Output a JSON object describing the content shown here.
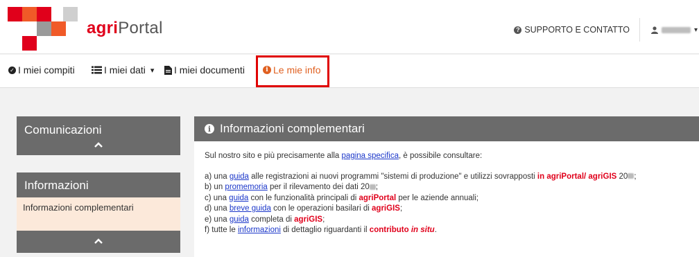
{
  "header": {
    "brand_part1": "agri",
    "brand_part2": "Portal",
    "support_label": "SUPPORTO E CONTATTO",
    "user_caret": "▾"
  },
  "nav": {
    "items": [
      {
        "label": "I miei compiti",
        "icon": "check-circle-icon"
      },
      {
        "label": "I miei dati",
        "icon": "list-icon",
        "caret": "▾"
      },
      {
        "label": "I miei documenti",
        "icon": "document-icon"
      },
      {
        "label": "Le mie info",
        "icon": "info-circle-icon",
        "active": true
      }
    ]
  },
  "sidebar": {
    "sections": [
      {
        "title": "Comunicazioni"
      },
      {
        "title": "Informazioni",
        "items": [
          "Informazioni complementari"
        ]
      }
    ]
  },
  "main": {
    "title": "Informazioni complementari",
    "intro": {
      "pre": "Sul nostro sito e più precisamente alla ",
      "link": "pagina specifica",
      "post": ", è possibile consultare:"
    },
    "lines": {
      "a_pre": "a) una ",
      "a_link": "guida",
      "a_mid": " alle registrazioni ai nuovi programmi \"sistemi di produzione\" e utilizzi sovrapposti ",
      "a_bold": "in agriPortal/ agriGIS",
      "a_year": " 20",
      "a_end": ";",
      "b_pre": "b) un ",
      "b_link": "promemoria",
      "b_mid": " per il rilevamento dei dati 20",
      "b_end": ";",
      "c_pre": "c) una ",
      "c_link": "guida",
      "c_mid": " con le funzionalità principali di ",
      "c_bold": "agriPortal",
      "c_end": " per le aziende annuali;",
      "d_pre": "d) una ",
      "d_link": "breve guida",
      "d_mid": " con le operazioni basilari di ",
      "d_bold": "agriGIS",
      "d_end": ";",
      "e_pre": "e) una ",
      "e_link": "guida",
      "e_mid": " completa di ",
      "e_bold": "agriGIS",
      "e_end": ";",
      "f_pre": "f) tutte le ",
      "f_link": "informazioni",
      "f_mid": " di dettaglio riguardanti il ",
      "f_bold": "contributo ",
      "f_bold_italic": "in situ",
      "f_end": "."
    }
  },
  "colors": {
    "brand_red": "#e0001b",
    "panel_gray": "#6b6b6b",
    "active_orange": "#e06020",
    "highlight_box": "#e00000",
    "link_blue": "#1a36c9",
    "sidebar_item_bg": "#fce9da"
  }
}
